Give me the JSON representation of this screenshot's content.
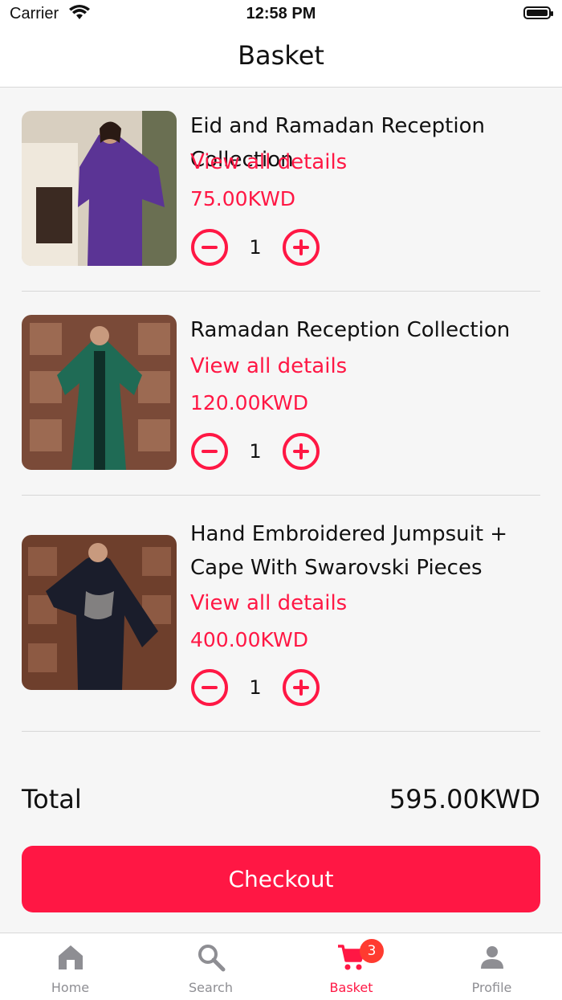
{
  "status_bar": {
    "carrier": "Carrier",
    "time": "12:58 PM"
  },
  "header": {
    "title": "Basket"
  },
  "basket": {
    "items": [
      {
        "name": "Eid and Ramadan Reception Collection",
        "details_label": "View all details",
        "price": "75.00KWD",
        "quantity": "1"
      },
      {
        "name": "Ramadan Reception Collection",
        "details_label": "View all details",
        "price": "120.00KWD",
        "quantity": "1"
      },
      {
        "name": "Hand Embroidered Jumpsuit + Cape With Swarovski Pieces",
        "details_label": "View all details",
        "price": "400.00KWD",
        "quantity": "1"
      }
    ]
  },
  "summary": {
    "total_label": "Total",
    "total_value": "595.00KWD"
  },
  "checkout_label": "Checkout",
  "tabbar": {
    "tabs": [
      {
        "label": "Home",
        "icon": "home-icon"
      },
      {
        "label": "Search",
        "icon": "search-icon"
      },
      {
        "label": "Basket",
        "icon": "cart-icon",
        "badge": "3"
      },
      {
        "label": "Profile",
        "icon": "person-icon"
      }
    ]
  },
  "colors": {
    "accent": "#ff1744",
    "badge": "#ff3b30",
    "inactive": "#8e8e93"
  }
}
